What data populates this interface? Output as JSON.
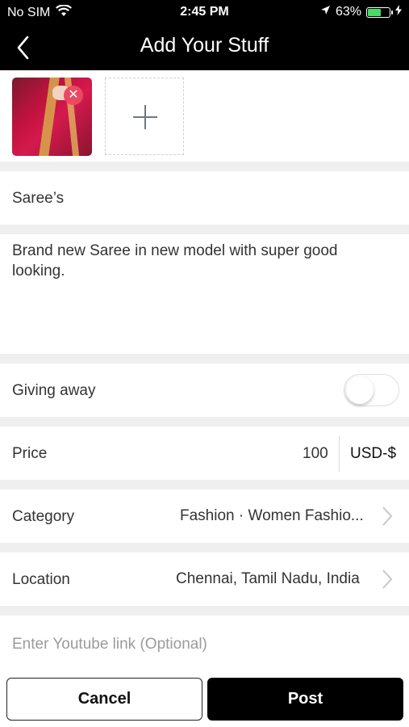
{
  "status_bar": {
    "carrier": "No SIM",
    "time": "2:45 PM",
    "battery_percent": "63%",
    "battery_level": 0.63,
    "battery_color": "#4cd964"
  },
  "nav": {
    "title": "Add Your Stuff",
    "back_icon": "chevron-left-icon"
  },
  "photos": {
    "remove_icon": "close-icon",
    "add_icon": "plus-icon"
  },
  "form": {
    "title": "Saree’s",
    "description": "Brand new Saree in new model with super good looking.",
    "giving_away_label": "Giving away",
    "giving_away_on": false,
    "price_label": "Price",
    "price_value": "100",
    "currency": "USD-$",
    "category_label": "Category",
    "category_value": "Fashion · Women Fashio...",
    "location_label": "Location",
    "location_value": "Chennai, Tamil Nadu, India",
    "youtube_placeholder": "Enter Youtube link (Optional)"
  },
  "actions": {
    "cancel_label": "Cancel",
    "post_label": "Post"
  },
  "colors": {
    "accent": "#000000",
    "remove": "#e94a61",
    "separator": "#efefef"
  }
}
